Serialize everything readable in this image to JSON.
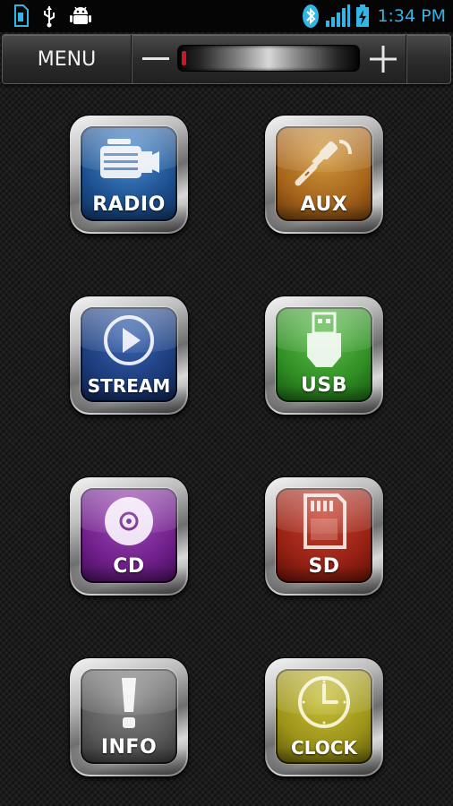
{
  "status_bar": {
    "time": "1:34 PM",
    "icons_left": [
      "sd-card-icon",
      "usb-icon",
      "android-debug-icon"
    ],
    "icons_right": [
      "bluetooth-icon",
      "signal-icon",
      "battery-charging-icon"
    ],
    "accent_color": "#33b5e5"
  },
  "menu_bar": {
    "menu_label": "MENU",
    "volume_minus_icon": "minus-icon",
    "volume_plus_icon": "plus-icon",
    "volume_level": 0.02
  },
  "tiles": [
    {
      "label": "RADIO",
      "icon": "radio-icon",
      "color": "#1c4e8c"
    },
    {
      "label": "AUX",
      "icon": "aux-jack-icon",
      "color": "#a5631b"
    },
    {
      "label": "STREAM",
      "icon": "play-icon",
      "color": "#1b3b7a"
    },
    {
      "label": "USB",
      "icon": "usb-stick-icon",
      "color": "#2f8d23"
    },
    {
      "label": "CD",
      "icon": "disc-icon",
      "color": "#6e1f89"
    },
    {
      "label": "SD",
      "icon": "sd-card-icon",
      "color": "#962114"
    },
    {
      "label": "INFO",
      "icon": "exclamation-icon",
      "color": "#5a5a5a"
    },
    {
      "label": "CLOCK",
      "icon": "clock-icon",
      "color": "#9b9218"
    }
  ]
}
